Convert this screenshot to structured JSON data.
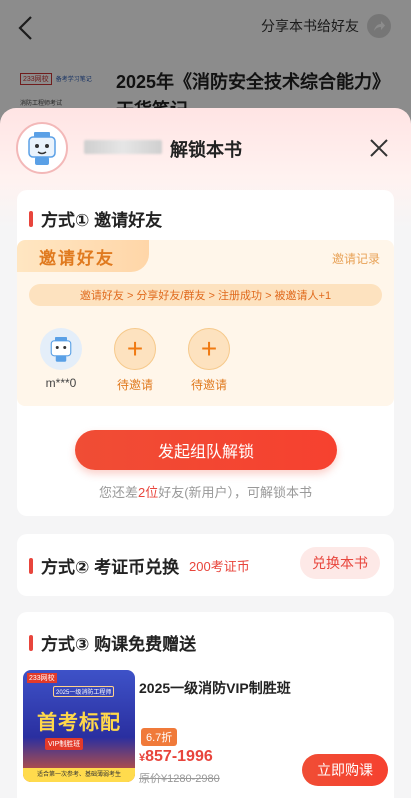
{
  "header": {
    "share_label": "分享本书给好友"
  },
  "book": {
    "title": "2025年《消防安全技术综合能力》干货笔记",
    "logo_brand": "233网校",
    "logo_sub": "备考学习笔记",
    "logo_caption": "消防工程师考试"
  },
  "sheet": {
    "title": "解锁本书",
    "method1": {
      "title": "方式① 邀请好友",
      "tab_label": "邀请好友",
      "record_label": "邀请记录",
      "steps": "邀请好友 > 分享好友/群友 > 注册成功 > 被邀请人+1",
      "slots": [
        {
          "label": "m***0"
        },
        {
          "label": "待邀请"
        },
        {
          "label": "待邀请"
        }
      ],
      "button_label": "发起组队解锁",
      "hint_before": "您还差",
      "hint_count": "2位",
      "hint_after": "好友(新用户），可解锁本书"
    },
    "method2": {
      "title": "方式② 考证币兑换",
      "cost": "200考证币",
      "button_label": "兑换本书"
    },
    "method3": {
      "title": "方式③ 购课免费赠送",
      "course_name": "2025一级消防VIP制胜班",
      "discount": "6.7折",
      "price_symbol": "¥",
      "price": "857-1996",
      "original_price": "原价¥1280-2980",
      "button_label": "立即购课",
      "image_brand": "233网校",
      "image_tag": "2025一级消防工程师",
      "image_headline": "首考标配",
      "image_badge": "VIP制胜班",
      "image_footer": "适合第一次参考、基础薄弱考生"
    }
  },
  "colors": {
    "accent": "#e8453c",
    "orange": "#e07a1f"
  }
}
